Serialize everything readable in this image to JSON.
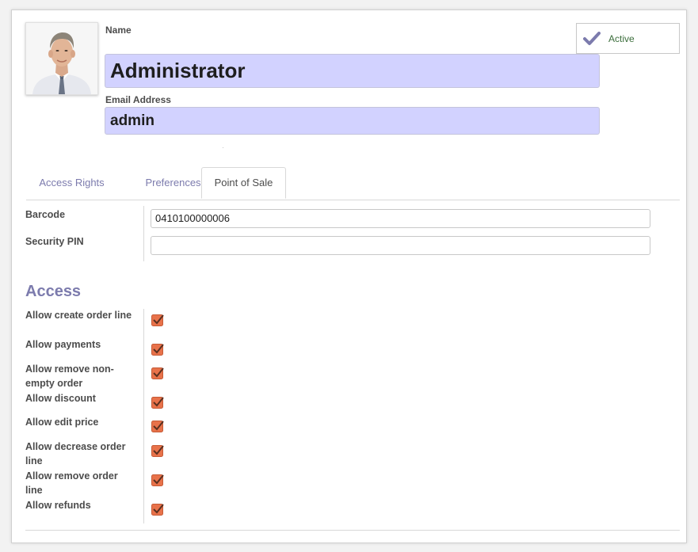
{
  "header": {
    "name_label": "Name",
    "name_value": "Administrator",
    "email_label": "Email Address",
    "email_value": "admin",
    "status_label": "Active"
  },
  "tabs": [
    {
      "label": "Access Rights",
      "active": false
    },
    {
      "label": "Preferences",
      "active": false
    },
    {
      "label": "Point of Sale",
      "active": true
    }
  ],
  "pos": {
    "barcode_label": "Barcode",
    "barcode_value": "0410100000006",
    "pin_label": "Security PIN",
    "pin_value": ""
  },
  "access": {
    "title": "Access",
    "items": [
      {
        "label": "Allow create order line",
        "checked": true
      },
      {
        "label": "Allow payments",
        "checked": true
      },
      {
        "label": "Allow remove non-empty order",
        "checked": true
      },
      {
        "label": "Allow discount",
        "checked": true
      },
      {
        "label": "Allow edit price",
        "checked": true
      },
      {
        "label": "Allow decrease order line",
        "checked": true
      },
      {
        "label": "Allow remove order line",
        "checked": true
      },
      {
        "label": "Allow refunds",
        "checked": true
      }
    ]
  },
  "colors": {
    "accent": "#7c7bad",
    "field_bg": "#d2d2ff",
    "checkbox": "#e8724a",
    "status_text": "#3c6e3c"
  },
  "icons": {
    "status": "checkmark-icon",
    "checkbox": "checked-checkbox-icon"
  }
}
